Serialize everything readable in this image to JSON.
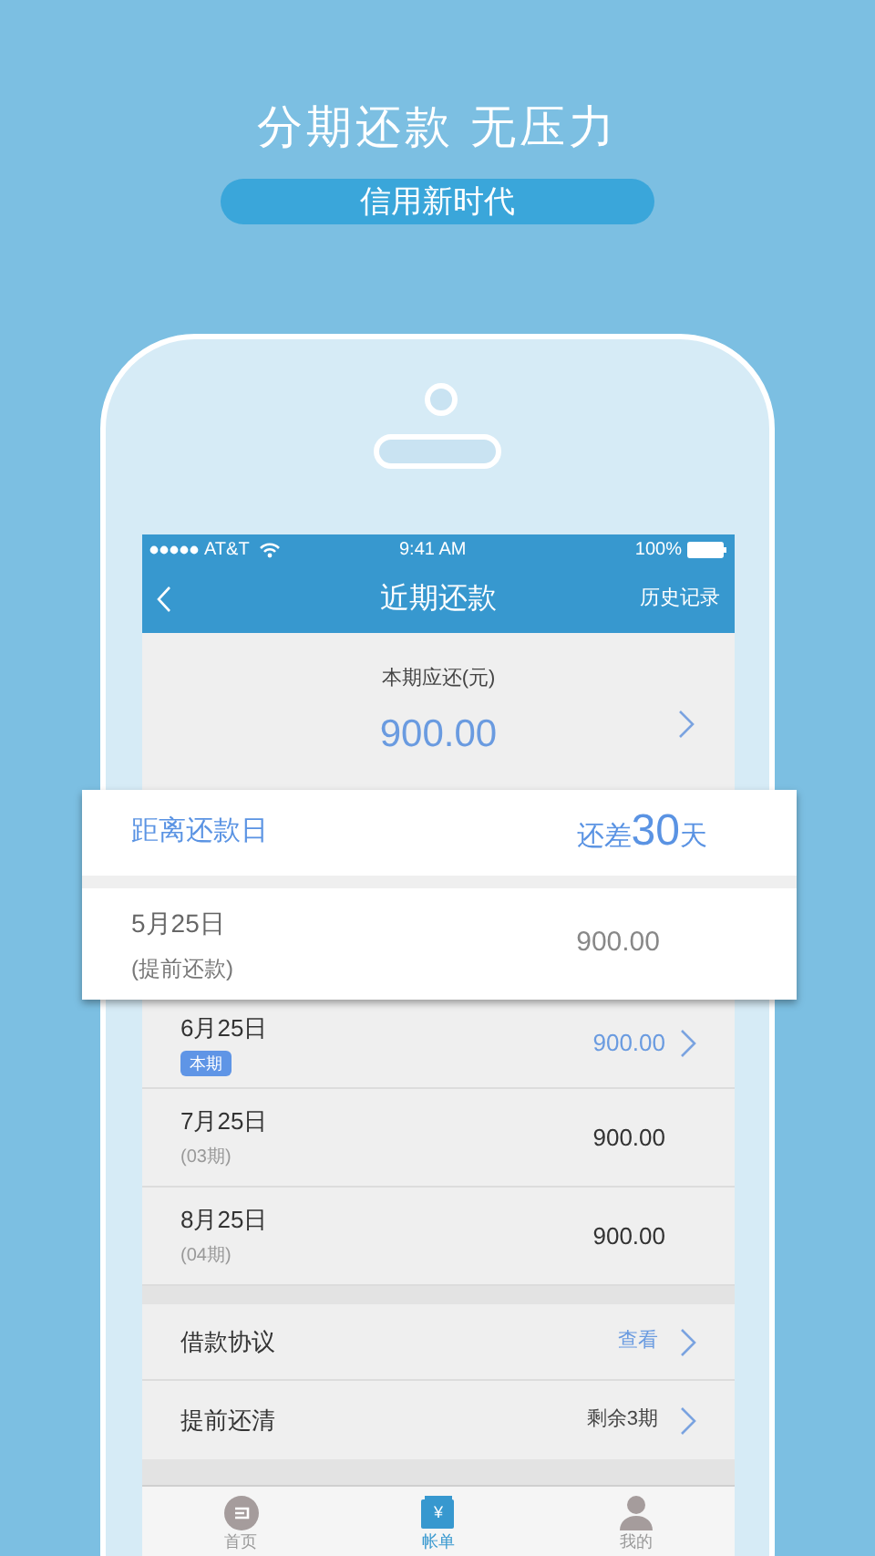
{
  "headline": "分期还款 无压力",
  "tagline": "信用新时代",
  "status_bar": {
    "carrier": "AT&T",
    "time": "9:41 AM",
    "battery": "100%"
  },
  "nav": {
    "title": "近期还款",
    "action": "历史记录"
  },
  "summary": {
    "label": "本期应还(元)",
    "amount": "900.00"
  },
  "highlight": {
    "label": "距离还款日",
    "prefix": "还差",
    "days": "30",
    "suffix": "天",
    "date": "5月25日",
    "note": "(提前还款)",
    "amount": "900.00"
  },
  "installments": [
    {
      "date": "6月25日",
      "badge": "本期",
      "amount": "900.00",
      "current": true
    },
    {
      "date": "7月25日",
      "note": "(03期)",
      "amount": "900.00",
      "current": false
    },
    {
      "date": "8月25日",
      "note": "(04期)",
      "amount": "900.00",
      "current": false
    }
  ],
  "links": [
    {
      "label": "借款协议",
      "value": "查看",
      "kind": "link"
    },
    {
      "label": "提前还清",
      "value": "剩余3期",
      "kind": "info"
    }
  ],
  "tabs": [
    {
      "label": "首页",
      "selected": false
    },
    {
      "label": "帐单",
      "glyph": "¥",
      "selected": true
    },
    {
      "label": "我的",
      "selected": false
    }
  ]
}
